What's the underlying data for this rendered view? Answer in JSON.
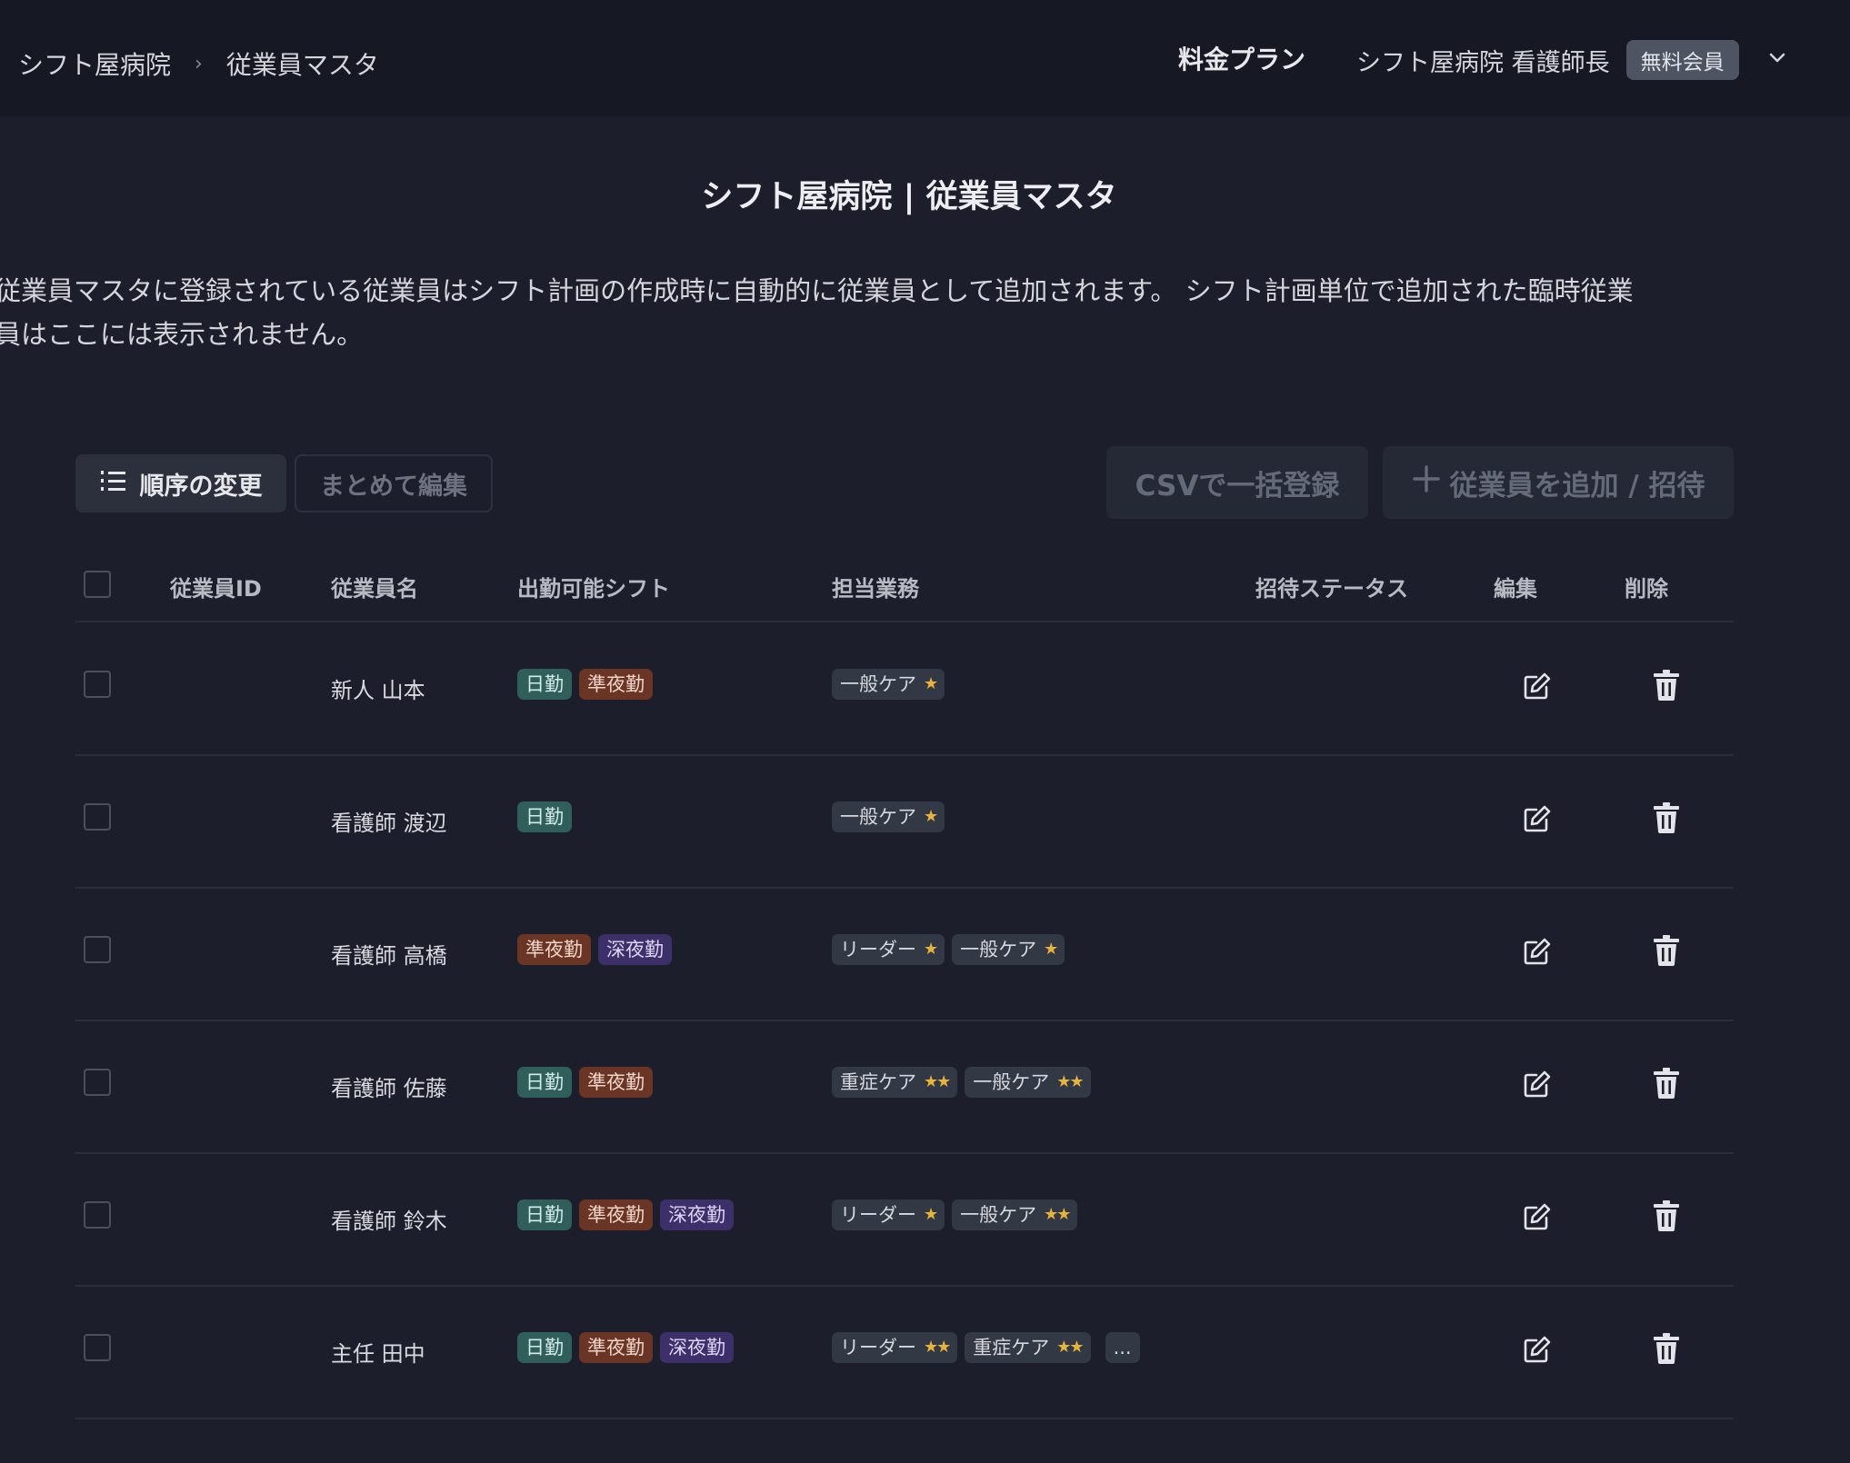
{
  "header": {
    "breadcrumb": [
      "シフト屋病院",
      "従業員マスタ"
    ],
    "breadcrumb_separator": "›",
    "plan_label": "料金プラン",
    "user_name": "シフト屋病院 看護師長",
    "member_badge": "無料会員"
  },
  "page": {
    "title": "シフト屋病院 | 従業員マスタ",
    "description_line1": "従業員マスタに登録されている従業員はシフト計画の作成時に自動的に従業員として追加されます。 シフト計画単位で追加された臨時従業",
    "description_line2": "員はここには表示されません。"
  },
  "toolbar": {
    "reorder_label": "順序の変更",
    "bulk_edit_label": "まとめて編集",
    "csv_label": "CSVで一括登録",
    "add_label": "従業員を追加 / 招待"
  },
  "table": {
    "columns": [
      "従業員ID",
      "従業員名",
      "出勤可能シフト",
      "担当業務",
      "招待ステータス",
      "編集",
      "削除"
    ],
    "rows": [
      {
        "id": "",
        "name": "新人 山本",
        "shifts": [
          {
            "label": "日勤",
            "kind": "day"
          },
          {
            "label": "準夜勤",
            "kind": "semi"
          }
        ],
        "duties": [
          {
            "label": "一般ケア",
            "stars": "★"
          }
        ],
        "status": ""
      },
      {
        "id": "",
        "name": "看護師 渡辺",
        "shifts": [
          {
            "label": "日勤",
            "kind": "day"
          }
        ],
        "duties": [
          {
            "label": "一般ケア",
            "stars": "★"
          }
        ],
        "status": ""
      },
      {
        "id": "",
        "name": "看護師 高橋",
        "shifts": [
          {
            "label": "準夜勤",
            "kind": "semi"
          },
          {
            "label": "深夜勤",
            "kind": "deep"
          }
        ],
        "duties": [
          {
            "label": "リーダー",
            "stars": "★"
          },
          {
            "label": "一般ケア",
            "stars": "★"
          }
        ],
        "status": ""
      },
      {
        "id": "",
        "name": "看護師 佐藤",
        "shifts": [
          {
            "label": "日勤",
            "kind": "day"
          },
          {
            "label": "準夜勤",
            "kind": "semi"
          }
        ],
        "duties": [
          {
            "label": "重症ケア",
            "stars": "★★"
          },
          {
            "label": "一般ケア",
            "stars": "★★"
          }
        ],
        "status": ""
      },
      {
        "id": "",
        "name": "看護師 鈴木",
        "shifts": [
          {
            "label": "日勤",
            "kind": "day"
          },
          {
            "label": "準夜勤",
            "kind": "semi"
          },
          {
            "label": "深夜勤",
            "kind": "deep"
          }
        ],
        "duties": [
          {
            "label": "リーダー",
            "stars": "★"
          },
          {
            "label": "一般ケア",
            "stars": "★★"
          }
        ],
        "status": ""
      },
      {
        "id": "",
        "name": "主任 田中",
        "shifts": [
          {
            "label": "日勤",
            "kind": "day"
          },
          {
            "label": "準夜勤",
            "kind": "semi"
          },
          {
            "label": "深夜勤",
            "kind": "deep"
          }
        ],
        "duties": [
          {
            "label": "リーダー",
            "stars": "★★"
          },
          {
            "label": "重症ケア",
            "stars": "★★"
          }
        ],
        "more": "...",
        "status": ""
      }
    ]
  },
  "icons": {
    "reorder": "list-ordered-icon",
    "add": "plus-icon",
    "dropdown": "chevron-down-icon",
    "edit": "edit-icon",
    "delete": "trash-icon"
  },
  "colors": {
    "background": "#1c1f2b",
    "topbar": "#161924",
    "tag_day": "#2f5e5b",
    "tag_semi": "#6a3524",
    "tag_deep": "#3c2f6a",
    "tag_duty": "#333845",
    "star": "#e6b43c"
  }
}
